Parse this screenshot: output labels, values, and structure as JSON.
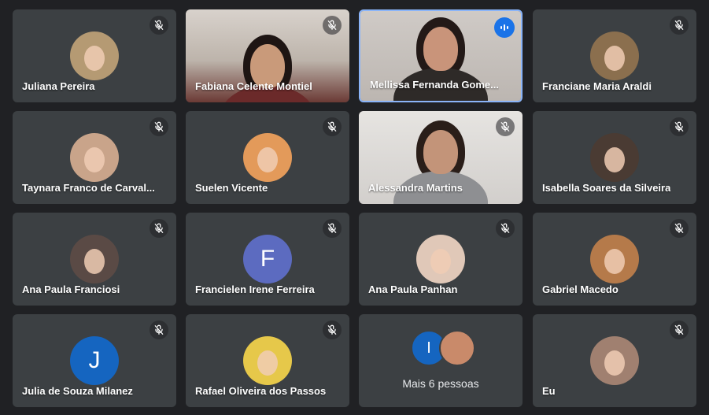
{
  "participants": [
    {
      "name": "Juliana Pereira",
      "type": "avatar",
      "muted": true,
      "avatar_color": "#b59a73"
    },
    {
      "name": "Fabiana Celente Montiel",
      "type": "video",
      "muted": true
    },
    {
      "name": "Mellissa Fernanda Gome...",
      "type": "video",
      "muted": false,
      "speaking": true
    },
    {
      "name": "Franciane Maria Araldi",
      "type": "avatar",
      "muted": true,
      "avatar_color": "#8b6f4e"
    },
    {
      "name": "Taynara Franco de Carval...",
      "type": "avatar",
      "muted": true,
      "avatar_color": "#c9a48a"
    },
    {
      "name": "Suelen Vicente",
      "type": "avatar",
      "muted": true,
      "avatar_color": "#e39a5a"
    },
    {
      "name": "Alessandra Martins",
      "type": "video",
      "muted": true
    },
    {
      "name": "Isabella Soares da Silveira",
      "type": "avatar",
      "muted": true,
      "avatar_color": "#4a3b33"
    },
    {
      "name": "Ana Paula Franciosi",
      "type": "avatar",
      "muted": true,
      "avatar_color": "#5a4a45"
    },
    {
      "name": "Francielen Irene Ferreira",
      "type": "letter",
      "letter": "F",
      "muted": true,
      "avatar_color": "#5c6bc0"
    },
    {
      "name": "Ana Paula Panhan",
      "type": "avatar",
      "muted": true,
      "avatar_color": "#e0c8b8"
    },
    {
      "name": "Gabriel Macedo",
      "type": "avatar",
      "muted": true,
      "avatar_color": "#b57a4a"
    },
    {
      "name": "Julia de Souza Milanez",
      "type": "letter",
      "letter": "J",
      "muted": true,
      "avatar_color": "#1565c0"
    },
    {
      "name": "Rafael Oliveira dos Passos",
      "type": "avatar",
      "muted": true,
      "avatar_color": "#e6c84a"
    },
    {
      "name": "more",
      "type": "more",
      "label": "Mais 6 pessoas",
      "letter": "I",
      "avatar_color": "#1565c0",
      "avatar2_color": "#c98a6a"
    },
    {
      "name": "Eu",
      "type": "avatar",
      "muted": true,
      "avatar_color": "#a08070"
    }
  ],
  "colors": {
    "background": "#202124",
    "tile": "#3c4043",
    "active_border": "#8ab4f8",
    "speaking_badge": "#1a73e8"
  },
  "icons": {
    "muted": "mic-off-icon",
    "speaking": "audio-wave-icon"
  }
}
